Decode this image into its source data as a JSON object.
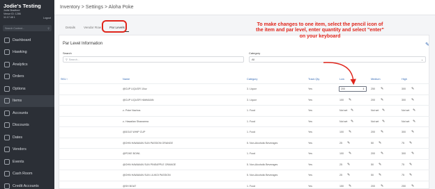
{
  "sidebar": {
    "title": "Jodie's Testing",
    "user": "Jodie Bradford",
    "venue": "Venue ID: 1286",
    "time": "11:17:48 1",
    "logout": "Logout",
    "search_placeholder": "Search Content...",
    "items": [
      {
        "label": "Dashboard"
      },
      {
        "label": "Hawking"
      },
      {
        "label": "Analytics"
      },
      {
        "label": "Orders"
      },
      {
        "label": "Options"
      },
      {
        "label": "Items"
      },
      {
        "label": "Accounts"
      },
      {
        "label": "Discounts"
      },
      {
        "label": "Dates"
      },
      {
        "label": "Vendors"
      },
      {
        "label": "Events"
      },
      {
        "label": "Cash Room"
      },
      {
        "label": "Credit Accounts"
      }
    ]
  },
  "breadcrumb": "Inventory > Settings > Aloha Poke",
  "tabs": [
    "Details",
    "Vendor Row",
    "Par Levels"
  ],
  "panel": {
    "title": "Par Level Information",
    "search_label": "Search",
    "search_placeholder": "Search...",
    "category_label": "Category",
    "category_value": "All"
  },
  "annotation": "To make changes to one item, select the pencil icon of the item and par level, enter quantity and select \"enter\" on your keyboard",
  "table": {
    "headers": [
      "SKU",
      "Name",
      "Category",
      "Track Qty",
      "Low",
      "Medium",
      "High"
    ],
    "sort_indicator": "↑",
    "rows": [
      {
        "sku": "",
        "name": "@CUP LIQUOR 10oz",
        "category": "3. Liquor",
        "track": "Yes",
        "low": "200",
        "medium": "250",
        "high": "300"
      },
      {
        "sku": "",
        "name": "@CUP LIQUOR HAWAIIAN",
        "category": "3. Liquor",
        "track": "Yes",
        "low": "100",
        "medium": "200",
        "high": "300"
      },
      {
        "sku": "",
        "name": "z- Poke Nachos",
        "category": "1. Food",
        "track": "Yes",
        "low": "Not set",
        "medium": "Not set",
        "high": "Not set"
      },
      {
        "sku": "",
        "name": "z- Hawaiian Shawarma",
        "category": "1. Food",
        "track": "Yes",
        "low": "Not set",
        "medium": "Not set",
        "high": "Not set"
      },
      {
        "sku": "",
        "name": "@DOLE WHIP CUP",
        "category": "1. Food",
        "track": "Yes",
        "low": "100",
        "medium": "200",
        "high": "300"
      },
      {
        "sku": "",
        "name": "@OHN HAWAIIAN SUN PASSION ORANGE",
        "category": "5. Non-Alcoholic Beverages",
        "track": "Yes",
        "low": "25",
        "medium": "50",
        "high": "75"
      },
      {
        "sku": "",
        "name": "@POKE BOWL",
        "category": "1. Food",
        "track": "Yes",
        "low": "100",
        "medium": "200",
        "high": "300"
      },
      {
        "sku": "",
        "name": "@OHN HAWAIIAN SUN PINEAPPLE ORANGE",
        "category": "5. Non-Alcoholic Beverages",
        "track": "Yes",
        "low": "25",
        "medium": "50",
        "high": "75"
      },
      {
        "sku": "",
        "name": "@OHN HAWAIIAN SUN LILIKOI PASSION",
        "category": "5. Non-Alcoholic Beverages",
        "track": "Yes",
        "low": "25",
        "medium": "50",
        "high": "75"
      },
      {
        "sku": "",
        "name": "@SH BOAT",
        "category": "1. Food",
        "track": "Yes",
        "low": "150",
        "medium": "200",
        "high": "250"
      }
    ]
  },
  "colors": {
    "accent": "#2f66b3",
    "annotation": "#e0251b",
    "sidebar": "#2b2f36"
  }
}
